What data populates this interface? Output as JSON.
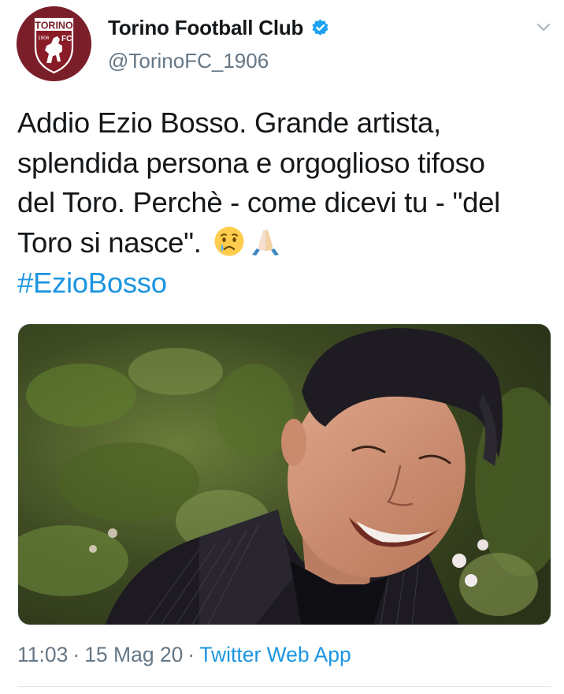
{
  "tweet": {
    "display_name": "Torino Football Club",
    "handle": "@TorinoFC_1906",
    "avatar": {
      "top_text": "TORINO",
      "year_text": "1906",
      "fc_text": "FC"
    },
    "text_lines": [
      "Addio Ezio Bosso. Grande artista,",
      "splendida persona e orgoglioso tifoso",
      "del Toro. Perchè - come dicevi tu - \"del",
      "Toro si nasce\"."
    ],
    "emojis": [
      "crying-face-emoji",
      "folded-hands-emoji"
    ],
    "hashtag": "#EzioBosso",
    "time": "11:03",
    "separator": "·",
    "date": "15 Mag 20",
    "source": "Twitter Web App"
  },
  "icons": {
    "verified": "verified-badge-icon",
    "more": "chevron-down-icon"
  },
  "colors": {
    "text": "#14171a",
    "secondary": "#657786",
    "link": "#1b95e0",
    "verified": "#1da1f2",
    "brand_maroon": "#7a1f2a"
  }
}
